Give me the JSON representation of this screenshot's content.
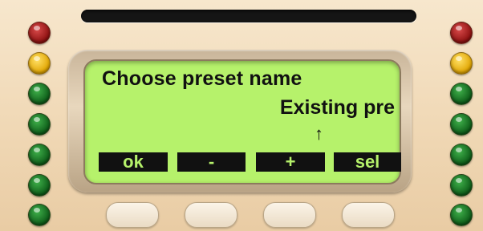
{
  "display": {
    "title_line": "Choose preset name",
    "preset_line": "Existing pre",
    "cursor": "↑"
  },
  "softkeys": [
    "ok",
    "-",
    "+",
    "sel"
  ],
  "colors": {
    "lcd_background": "#b6f26b",
    "lcd_text": "#111111",
    "panel": "#f1dcbb",
    "led_red": "#8c1010",
    "led_yellow": "#e0a400",
    "led_green": "#0d5b18"
  },
  "leds": {
    "left": [
      "red",
      "yellow",
      "green",
      "green",
      "green",
      "green",
      "green"
    ],
    "right": [
      "red",
      "yellow",
      "green",
      "green",
      "green",
      "green",
      "green"
    ]
  }
}
